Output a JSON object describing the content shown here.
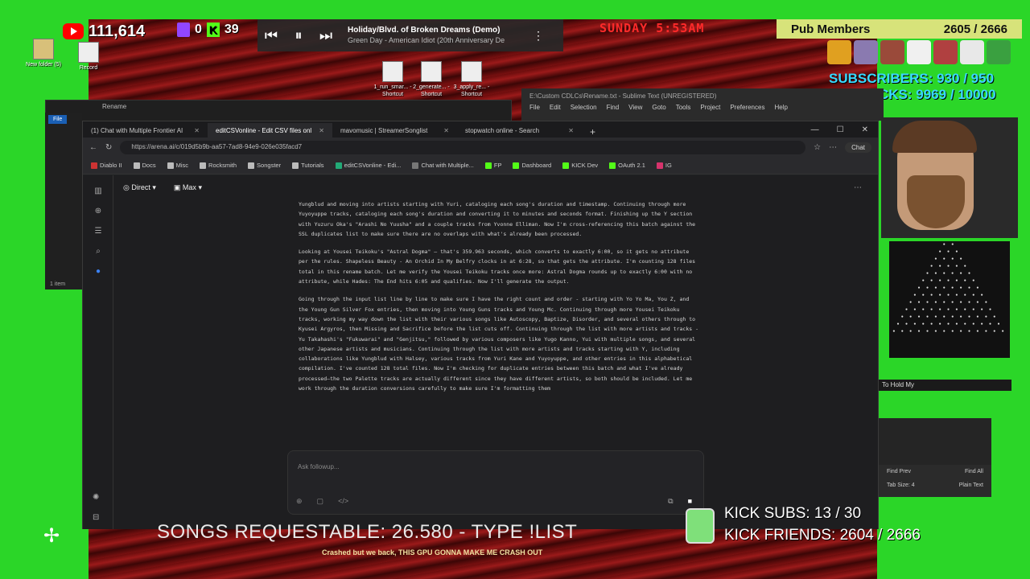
{
  "overlay": {
    "youtube_count": "111,614",
    "twitch_count": "0",
    "kick_count": "39",
    "player": {
      "title": "Holiday/Blvd. of Broken Dreams (Demo)",
      "artist": "Green Day - American Idiot (20th Anniversary De"
    },
    "clock": "SUNDAY 5:53AM",
    "pub_members_label": "Pub Members",
    "pub_members_count": "2605 / 2666",
    "subscribers": "SUBSCRIBERS: 930 / 950",
    "kicks": "KICKS: 9969 / 10000",
    "songs_requestable": "SONGS REQUESTABLE: 26.580 - TYPE !LIST",
    "kick_subs": "KICK SUBS: 13 / 30",
    "kick_friends": "KICK FRIENDS: 2604 / 2666",
    "ticker": "Crashed but we back, THIS GPU GONNA MAKE ME CRASH OUT"
  },
  "desktop": {
    "icons": [
      {
        "label": "New folder (5)"
      },
      {
        "label": "Record"
      },
      {
        "label": "1_run_smar... - Shortcut"
      },
      {
        "label": "2_generate... - Shortcut"
      },
      {
        "label": "3_apply_re... - Shortcut"
      }
    ],
    "rename_title": "Rename",
    "explorer_file": "File",
    "explorer_count": "1 item"
  },
  "sublime": {
    "title": "E:\\Custom CDLCs\\Rename.txt - Sublime Text (UNREGISTERED)",
    "menu": [
      "File",
      "Edit",
      "Selection",
      "Find",
      "View",
      "Goto",
      "Tools",
      "Project",
      "Preferences",
      "Help"
    ],
    "find_prev": "Find Prev",
    "find_all": "Find All",
    "tab_size": "Tab Size: 4",
    "plain_text": "Plain Text",
    "hold_text": "To Hold My"
  },
  "browser": {
    "tabs": [
      {
        "label": "(1) Chat with Multiple Frontier AI"
      },
      {
        "label": "editCSVonline - Edit CSV files onl"
      },
      {
        "label": "mavomusic | StreamerSonglist"
      },
      {
        "label": "stopwatch online - Search"
      }
    ],
    "url": "https://arena.ai/c/019d5b9b-aa57-7ad8-94e9-026e035facd7",
    "chat_label": "Chat",
    "bookmarks": [
      "Diablo II",
      "Docs",
      "Misc",
      "Rocksmith",
      "Songster",
      "Tutorials",
      "editCSVonline - Edi...",
      "Chat with Multiple...",
      "FP",
      "Dashboard",
      "KICK Dev",
      "OAuth 2.1",
      "IG"
    ],
    "mode_label": "Direct",
    "model_label": "Max",
    "followup_placeholder": "Ask followup..."
  },
  "content": {
    "paragraphs": [
      "Yungblud and moving into artists starting with Yuri, cataloging each song's duration and timestamp. Continuing through more Yuyoyuppe tracks, cataloging each song's duration and converting it to minutes and seconds format. Finishing up the Y section with Yuzuru Oka's \"Arashi No Yuusha\" and a couple tracks from Yvonne Elliman. Now I'm cross-referencing this batch against the SSL duplicates list to make sure there are no overlaps with what's already been processed.",
      "Looking at Yousei Teikoku's \"Astral Dogma\" — that's 359.963 seconds, which converts to exactly 6:00, so it gets no attribute per the rules. Shapeless Beauty - An Orchid In My Belfry clocks in at 6:28, so that gets the attribute. I'm counting 128 files total in this rename batch. Let me verify the Yousei Teikoku tracks once more: Astral Dogma rounds up to exactly 6:00 with no attribute, while Hades: The End hits 6:05 and qualifies. Now I'll generate the output.",
      "Going through the input list line by line to make sure I have the right count and order - starting with Yo Yo Ma, You Z, and the Young Gun Silver Fox entries, then moving into Young Guns tracks and Young Mc. Continuing through more Yousei Teikoku tracks, working my way down the list with their various songs like Autoscopy, Baptize, Disorder, and several others through to Kyusei Argyros, then Missing and Sacrifice before the list cuts off. Continuing through the list with more artists and tracks - Yu Takahashi's \"Fukuwarai\" and \"Genjitsu,\" followed by various composers like Yugo Kanno, Yui with multiple songs, and several other Japanese artists and musicians. Continuing through the list with more artists and tracks starting with Y, including collaborations like Yungblud with Halsey, various tracks from Yuri Kane and Yuyoyuppe, and other entries in this alphabetical compilation. I've counted 128 total files. Now I'm checking for duplicate entries between this batch and what I've already processed—the two Palette tracks are actually different since they have different artists, so both should be included. Let me work through the duration conversions carefully to make sure I'm formatting them"
    ]
  },
  "colors": {
    "chroma_green": "#2bd628",
    "browser_bg": "#1e1e20",
    "accent_cyan": "#39d9ff",
    "clock_red": "#ff2a2a"
  }
}
